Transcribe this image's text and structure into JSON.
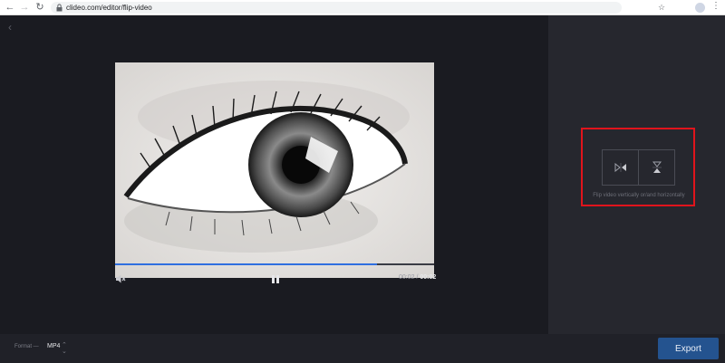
{
  "browser": {
    "url": "clideo.com/editor/flip-video"
  },
  "player": {
    "progress": 0.82,
    "current_time": "00:02",
    "separator": "/",
    "duration": "00:02"
  },
  "panel": {
    "flip_caption": "Flip video vertically or/and horizontally"
  },
  "footer": {
    "format_label": "Format",
    "format_value": "MP4",
    "export_label": "Export"
  },
  "colors": {
    "accent": "#2f6fe0",
    "export": "#24538f",
    "highlight": "#e0141c"
  }
}
